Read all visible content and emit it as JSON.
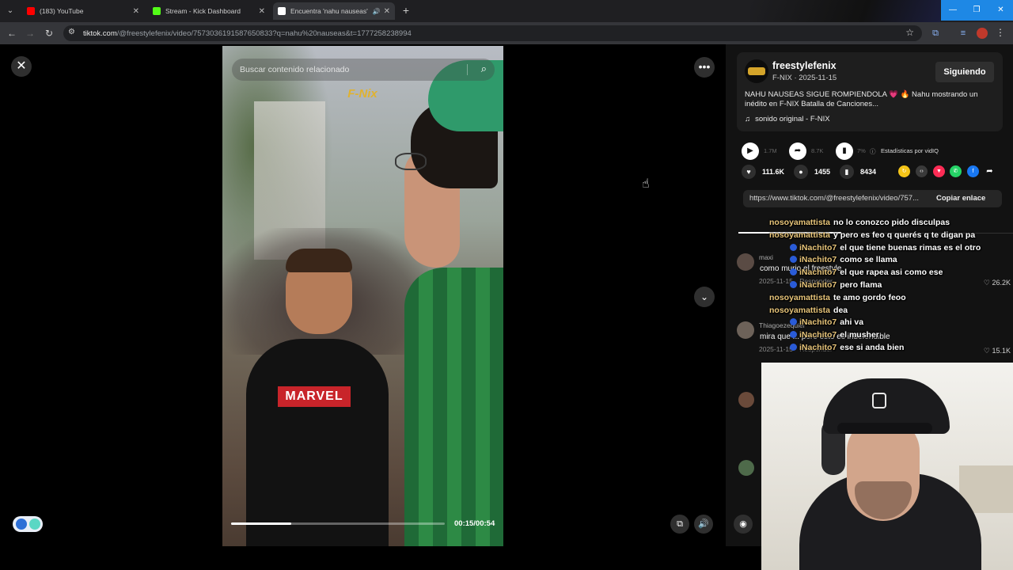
{
  "browser": {
    "tabs": [
      {
        "title": "(183) YouTube",
        "color": "#ff0000"
      },
      {
        "title": "Stream - Kick Dashboard",
        "color": "#53fc18"
      },
      {
        "title": "Encuentra 'nahu nauseas' e...",
        "color": "#ffffff"
      }
    ],
    "url_host": "tiktok.com",
    "url_path": "/@freestylefenix/video/7573036191587650833?q=nahu%20nauseas&t=1777258238994"
  },
  "player": {
    "search_placeholder": "Buscar contenido relacionado",
    "watermark": "F-Nix",
    "shirt_logo": "MARVEL",
    "current_time": "00:15/00:54",
    "progress_fraction": 0.28
  },
  "post": {
    "author": "freestylefenix",
    "subtitle": "F-NIX · 2025-11-15",
    "follow_label": "Siguiendo",
    "description": "NAHU NAUSEAS SIGUE ROMPIENDOLA 💗 🔥 Nahu mostrando un inédito en F-NIX Batalla de Canciones...",
    "music": "sonido original - F-NIX"
  },
  "stats": {
    "plays": "1.7M",
    "shares_dim": "8.7K",
    "engagement": "7%",
    "vidiq_label": "Estadísticas por vidIQ",
    "likes": "111.6K",
    "comments": "1455",
    "saves": "8434",
    "link": "https://www.tiktok.com/@freestylefenix/video/757...",
    "copy_label": "Copiar enlace"
  },
  "comments": [
    {
      "user": "maxi",
      "text": "como murio el freestyle",
      "date": "2025-11-15",
      "reply": "Responder",
      "likes": "26.2K"
    },
    {
      "user": "Thiagoezequiel",
      "text": "mira que ... pero esto es indefendible",
      "date": "2025-11-15",
      "reply": "Responder",
      "likes": "15.1K"
    }
  ],
  "chat": [
    {
      "user": "nosoyamattista",
      "msg": "no lo conozco pido disculpas",
      "kind": "u1",
      "badge": false
    },
    {
      "user": "nosoyamattista",
      "msg": "y pero es feo q querés q te digan pa",
      "kind": "u1",
      "badge": false
    },
    {
      "user": "iNachito7",
      "msg": "el que tiene buenas rimas es el otro",
      "kind": "u1",
      "badge": true
    },
    {
      "user": "iNachito7",
      "msg": "como se llama",
      "kind": "u1",
      "badge": true
    },
    {
      "user": "iNachito7",
      "msg": "el que rapea asi como ese",
      "kind": "u1",
      "badge": true
    },
    {
      "user": "iNachito7",
      "msg": "pero flama",
      "kind": "u1",
      "badge": true
    },
    {
      "user": "nosoyamattista",
      "msg": "te amo gordo feoo",
      "kind": "u1",
      "badge": false
    },
    {
      "user": "nosoyamattista",
      "msg": "dea",
      "kind": "u1",
      "badge": false
    },
    {
      "user": "iNachito7",
      "msg": "ahi va",
      "kind": "u1",
      "badge": true
    },
    {
      "user": "iNachito7",
      "msg": "el musher",
      "kind": "u1",
      "badge": true
    },
    {
      "user": "iNachito7",
      "msg": "ese si anda bien",
      "kind": "u1",
      "badge": true
    }
  ],
  "colors": {
    "accent": "#fe2c55",
    "panel": "#121212",
    "chat_user": "#e8c57a"
  }
}
